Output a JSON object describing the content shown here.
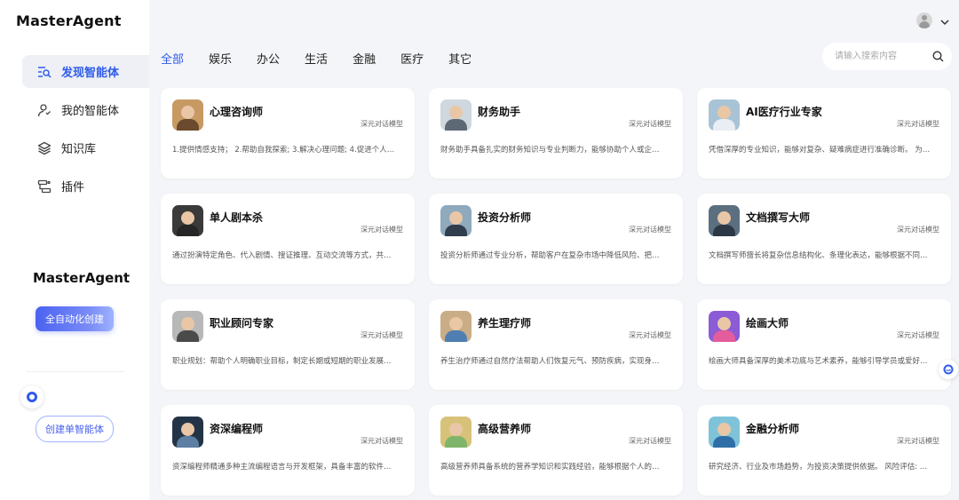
{
  "app": {
    "logo": "MasterAgent"
  },
  "sidebar": {
    "items": [
      {
        "label": "发现智能体",
        "icon": "discover-icon",
        "active": true
      },
      {
        "label": "我的智能体",
        "icon": "user-agent-icon",
        "active": false
      },
      {
        "label": "知识库",
        "icon": "layers-icon",
        "active": false
      },
      {
        "label": "插件",
        "icon": "plugin-icon",
        "active": false
      }
    ],
    "promo_logo": "MasterAgent",
    "auto_create_label": "全自动化创建",
    "single_create_label": "创建单智能体"
  },
  "tabs": [
    {
      "label": "全部",
      "active": true
    },
    {
      "label": "娱乐",
      "active": false
    },
    {
      "label": "办公",
      "active": false
    },
    {
      "label": "生活",
      "active": false
    },
    {
      "label": "金融",
      "active": false
    },
    {
      "label": "医疗",
      "active": false
    },
    {
      "label": "其它",
      "active": false
    }
  ],
  "search": {
    "placeholder": "请输入搜索内容"
  },
  "cards": [
    {
      "name": "心理咨询师",
      "model": "深元对话模型",
      "desc": "1.提供情感支持； 2.帮助自我探索; 3.解决心理问题; 4.促进个人…",
      "bg": "#c79a64",
      "shirt": "#6b4a2d"
    },
    {
      "name": "财务助手",
      "model": "深元对话模型",
      "desc": "财务助手具备扎实的财务知识与专业判断力，能够协助个人或企…",
      "bg": "#cfd8de",
      "shirt": "#5d6a75"
    },
    {
      "name": "AI医疗行业专家",
      "model": "深元对话模型",
      "desc": "凭借深厚的专业知识，能够对复杂、疑难病症进行准确诊断。 为…",
      "bg": "#a9c3d6",
      "shirt": "#e8eef3"
    },
    {
      "name": "单人剧本杀",
      "model": "深元对话模型",
      "desc": "通过扮演特定角色、代入剧情、搜证推理、互动交流等方式，共…",
      "bg": "#3a3a3a",
      "shirt": "#262626"
    },
    {
      "name": "投资分析师",
      "model": "深元对话模型",
      "desc": "投资分析师通过专业分析，帮助客户在复杂市场中降低风险、把…",
      "bg": "#8fa9bd",
      "shirt": "#2f3d4d"
    },
    {
      "name": "文档撰写大师",
      "model": "深元对话模型",
      "desc": "文档撰写师擅长将复杂信息结构化、条理化表达，能够根据不同…",
      "bg": "#5b6f80",
      "shirt": "#2c3846"
    },
    {
      "name": "职业顾问专家",
      "model": "深元对话模型",
      "desc": "职业规划：帮助个人明确职业目标，制定长期或短期的职业发展…",
      "bg": "#b8b8b8",
      "shirt": "#4a4a4a"
    },
    {
      "name": "养生理疗师",
      "model": "深元对话模型",
      "desc": "养生治疗师通过自然疗法帮助人们恢复元气、预防疾病，实现身…",
      "bg": "#c9ad86",
      "shirt": "#4f7fb0"
    },
    {
      "name": "绘画大师",
      "model": "深元对话模型",
      "desc": "绘画大师具备深厚的美术功底与艺术素养，能够引导学员或爱好…",
      "bg": "#8c5bd6",
      "shirt": "#e45c9c"
    },
    {
      "name": "资深编程师",
      "model": "深元对话模型",
      "desc": "资深编程师精通多种主流编程语言与开发框架，具备丰富的软件…",
      "bg": "#243447",
      "shirt": "#5c7fa3"
    },
    {
      "name": "高级营养师",
      "model": "深元对话模型",
      "desc": "高级营养师具备系统的营养学知识和实践经验，能够根据个人的…",
      "bg": "#d7c27a",
      "shirt": "#7fb56a"
    },
    {
      "name": "金融分析师",
      "model": "深元对话模型",
      "desc": "研究经济、行业及市场趋势，为投资决策提供依据。 风险评估: …",
      "bg": "#7fc3d9",
      "shirt": "#2f6fa8"
    }
  ]
}
